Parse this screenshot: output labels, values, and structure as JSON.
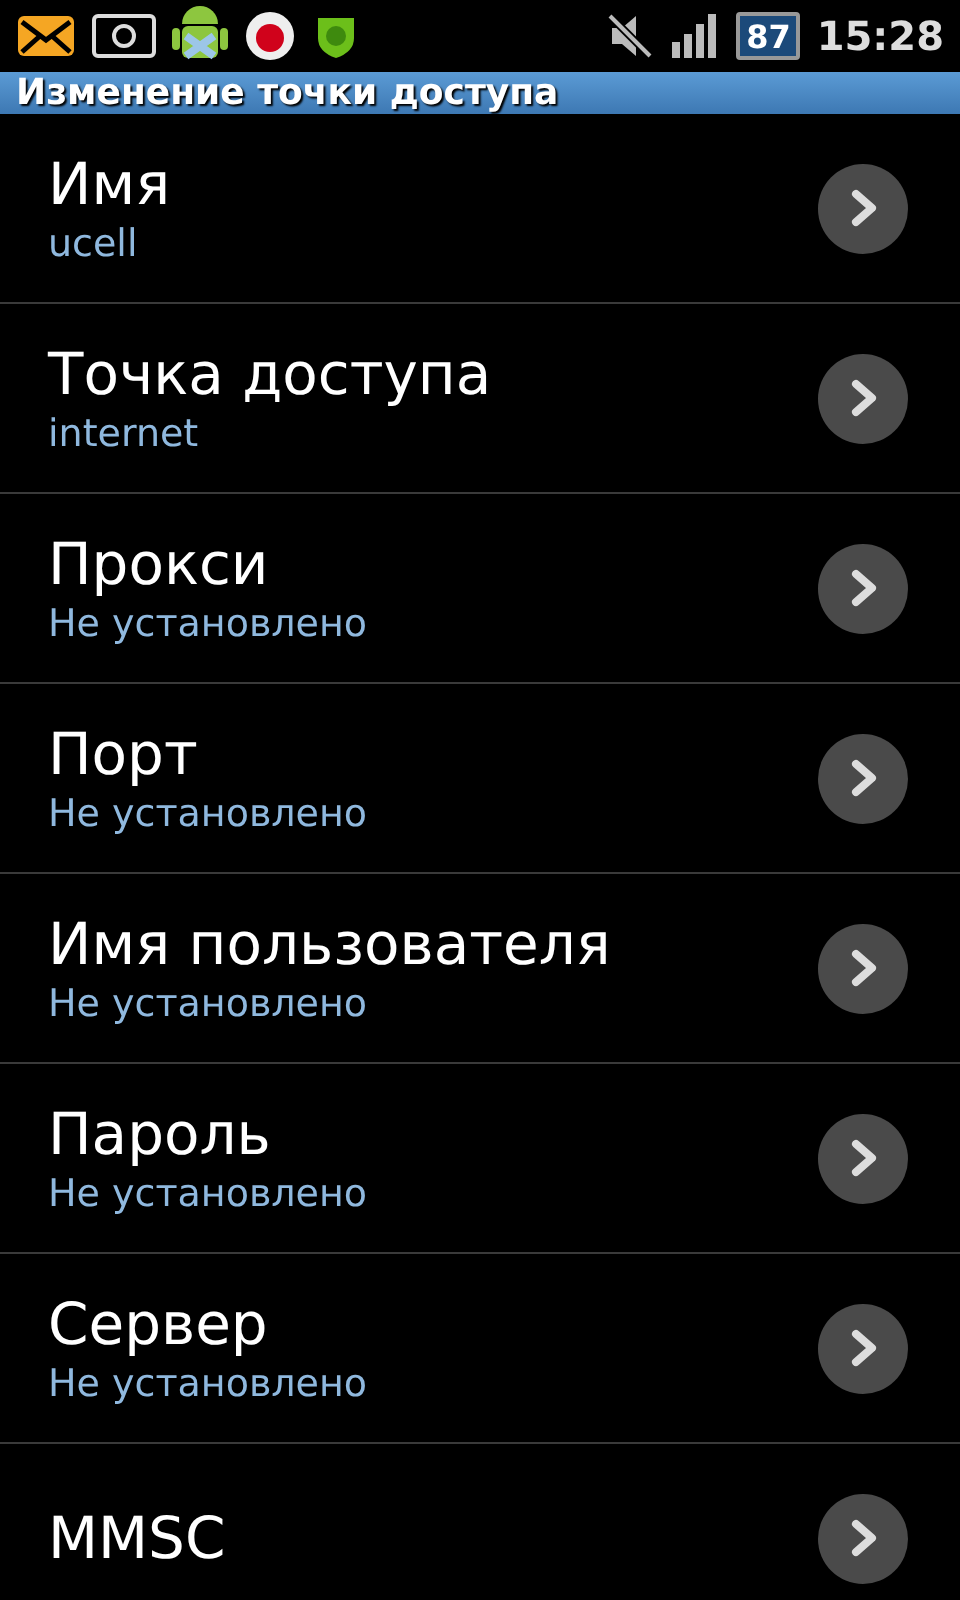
{
  "status_bar": {
    "battery": "87",
    "time": "15:28"
  },
  "title": "Изменение точки доступа",
  "items": [
    {
      "label": "Имя",
      "value": "ucell"
    },
    {
      "label": "Точка доступа",
      "value": "internet"
    },
    {
      "label": "Прокси",
      "value": "Не установлено"
    },
    {
      "label": "Порт",
      "value": "Не установлено"
    },
    {
      "label": "Имя пользователя",
      "value": "Не установлено"
    },
    {
      "label": "Пароль",
      "value": "Не установлено"
    },
    {
      "label": "Сервер",
      "value": "Не установлено"
    },
    {
      "label": "MMSC"
    }
  ]
}
